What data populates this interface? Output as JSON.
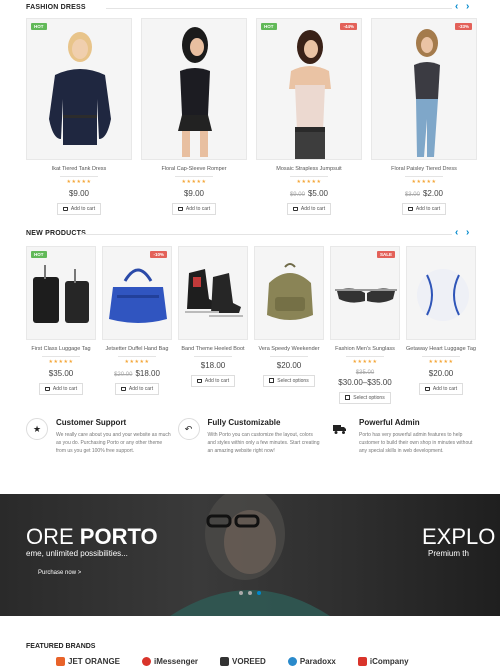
{
  "fashion": {
    "title": "FASHION DRESS",
    "products": [
      {
        "name": "Ikat Tiered Tank Dress",
        "badge": "HOT",
        "old_price": "",
        "price": "$9.00",
        "button": "Add to cart"
      },
      {
        "name": "Floral Cap-Sleeve Romper",
        "badge": "",
        "old_price": "",
        "price": "$9.00",
        "button": "Add to cart"
      },
      {
        "name": "Mosaic Strapless Jumpsuit",
        "badge": "HOT",
        "badge2": "-44%",
        "old_price": "$9.00",
        "price": "$5.00",
        "button": "Add to cart"
      },
      {
        "name": "Floral Paisley Tiered Dress",
        "badge": "-33%",
        "old_price": "$3.00",
        "price": "$2.00",
        "button": "Add to cart"
      }
    ]
  },
  "new_products": {
    "title": "NEW PRODUCTS",
    "products": [
      {
        "name": "First Class Luggage Tag",
        "badge": "HOT",
        "old_price": "",
        "price": "$35.00",
        "button": "Add to cart"
      },
      {
        "name": "Jetsetter Duffel Hand Bag",
        "badge": "-10%",
        "old_price": "$20.00",
        "price": "$18.00",
        "button": "Add to cart"
      },
      {
        "name": "Band Theme Heeled Boot",
        "badge": "",
        "old_price": "",
        "price": "$18.00",
        "button": "Add to cart"
      },
      {
        "name": "Vera Speedy Weekender",
        "badge": "",
        "old_price": "",
        "price": "$20.00",
        "button": "Select options"
      },
      {
        "name": "Fashion Men's Sunglass",
        "badge": "SALE",
        "old_price": "$35.00",
        "price": "$30.00–$35.00",
        "button": "Select options"
      },
      {
        "name": "Getaway Heart Luggage Tag",
        "badge": "",
        "old_price": "",
        "price": "$20.00",
        "button": "Add to cart"
      }
    ]
  },
  "features": [
    {
      "title": "Customer Support",
      "desc": "We really care about you and your website as much as you do. Purchasing Porto or any other theme from us you get 100% free support.",
      "icon": "star-icon"
    },
    {
      "title": "Fully Customizable",
      "desc": "With Porto you can customize the layout, colors and styles within only a few minutes. Start creating an amazing website right now!",
      "icon": "reply-icon"
    },
    {
      "title": "Powerful Admin",
      "desc": "Porto has very powerful admin features to help customer to build their own shop in minutes without any special skills in web development.",
      "icon": "truck-icon"
    }
  ],
  "hero": {
    "title_pre": "ORE ",
    "title_bold": "PORTO",
    "subtitle": "eme, unlimited possibilities...",
    "link": "Purchase now >",
    "title2": "EXPLO",
    "subtitle2": "Premium th"
  },
  "brands": {
    "title": "FEATURED BRANDS",
    "items": [
      "JET ORANGE",
      "iMessenger",
      "VOREED",
      "Paradoxx",
      "iCompany"
    ]
  },
  "colors": {
    "accent": "#0088cc",
    "hot": "#62b959",
    "sale": "#e36159",
    "star": "#f4a73a"
  }
}
